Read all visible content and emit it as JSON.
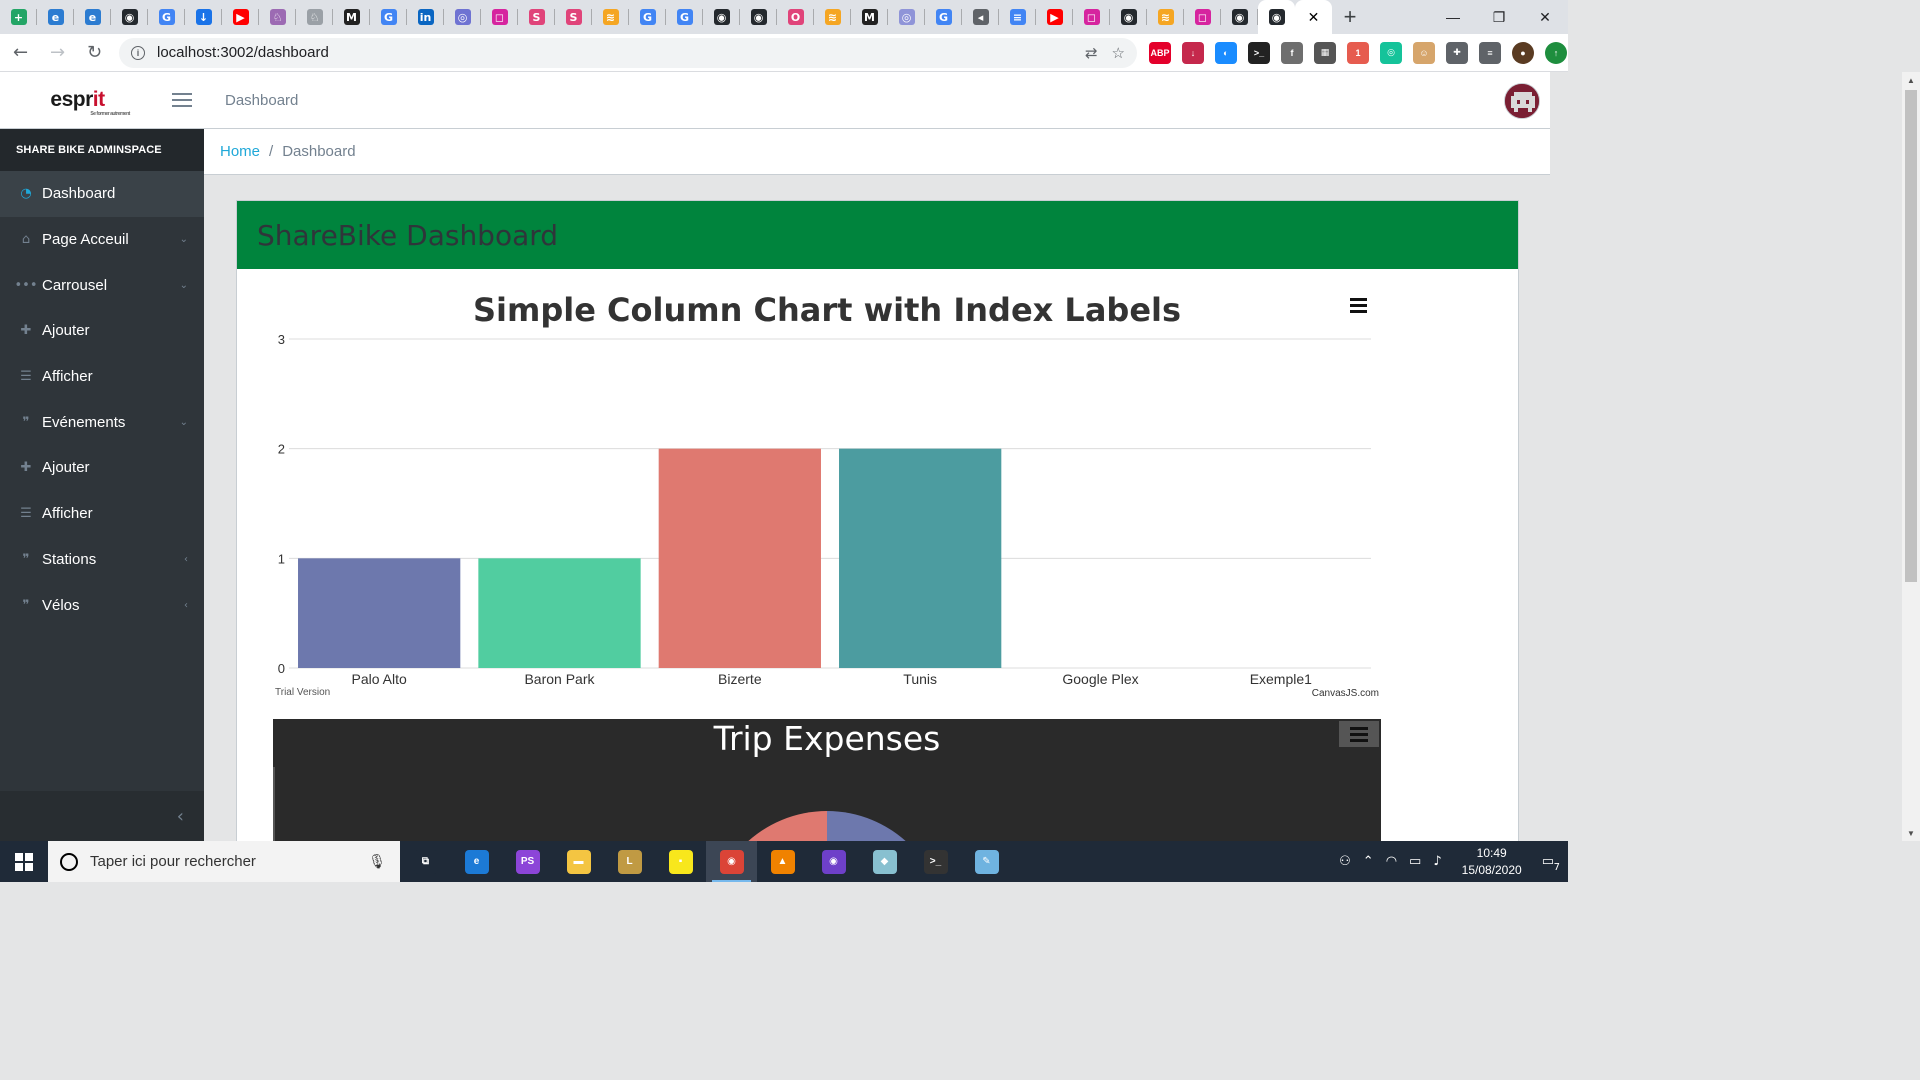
{
  "browser": {
    "tabs": [
      {
        "icon": "sheets-icon",
        "color": "#23a566",
        "glyph": "+"
      },
      {
        "icon": "edge-icon",
        "color": "#2c7cd1",
        "glyph": "e"
      },
      {
        "icon": "edge-icon",
        "color": "#2c7cd1",
        "glyph": "e"
      },
      {
        "icon": "github-icon",
        "color": "#24292e",
        "glyph": "◉"
      },
      {
        "icon": "google-icon",
        "color": "#4285f4",
        "glyph": "G"
      },
      {
        "icon": "download-icon",
        "color": "#1a73e8",
        "glyph": "↓"
      },
      {
        "icon": "youtube-icon",
        "color": "#ff0000",
        "glyph": "▶"
      },
      {
        "icon": "app-icon",
        "color": "#9c6ab3",
        "glyph": "♘"
      },
      {
        "icon": "app-icon",
        "color": "#9aa0a6",
        "glyph": "♘"
      },
      {
        "icon": "medium-icon",
        "color": "#222222",
        "glyph": "M"
      },
      {
        "icon": "google-icon",
        "color": "#4285f4",
        "glyph": "G"
      },
      {
        "icon": "linkedin-icon",
        "color": "#0a66c2",
        "glyph": "in"
      },
      {
        "icon": "app-icon",
        "color": "#6f73d2",
        "glyph": "◎"
      },
      {
        "icon": "instagram-icon",
        "color": "#d6249f",
        "glyph": "◻"
      },
      {
        "icon": "app-icon",
        "color": "#e0447a",
        "glyph": "S"
      },
      {
        "icon": "app-icon",
        "color": "#e0447a",
        "glyph": "S"
      },
      {
        "icon": "app-icon",
        "color": "#f5a623",
        "glyph": "≋"
      },
      {
        "icon": "google-icon",
        "color": "#4285f4",
        "glyph": "G"
      },
      {
        "icon": "google-icon",
        "color": "#4285f4",
        "glyph": "G"
      },
      {
        "icon": "github-icon",
        "color": "#24292e",
        "glyph": "◉"
      },
      {
        "icon": "github-icon",
        "color": "#24292e",
        "glyph": "◉"
      },
      {
        "icon": "opera-icon",
        "color": "#e0447a",
        "glyph": "O"
      },
      {
        "icon": "app-icon",
        "color": "#f5a623",
        "glyph": "≋"
      },
      {
        "icon": "medium-icon",
        "color": "#222222",
        "glyph": "M"
      },
      {
        "icon": "app-icon",
        "color": "#8f94d8",
        "glyph": "◎"
      },
      {
        "icon": "google-icon",
        "color": "#4285f4",
        "glyph": "G"
      },
      {
        "icon": "audio-icon",
        "color": "#5f6368",
        "glyph": "◂"
      },
      {
        "icon": "docs-icon",
        "color": "#4285f4",
        "glyph": "≡"
      },
      {
        "icon": "youtube-icon",
        "color": "#ff0000",
        "glyph": "▶"
      },
      {
        "icon": "instagram-icon",
        "color": "#d6249f",
        "glyph": "◻"
      },
      {
        "icon": "github-icon",
        "color": "#24292e",
        "glyph": "◉"
      },
      {
        "icon": "app-icon",
        "color": "#f5a623",
        "glyph": "≋"
      },
      {
        "icon": "instagram-icon",
        "color": "#d6249f",
        "glyph": "◻"
      },
      {
        "icon": "github-icon",
        "color": "#24292e",
        "glyph": "◉"
      },
      {
        "icon": "github-icon",
        "color": "#24292e",
        "glyph": "◉",
        "active": true
      }
    ],
    "active_tab_close": "✕",
    "new_tab": "+",
    "url": "localhost:3002/dashboard",
    "extensions": [
      {
        "icon": "adblock-icon",
        "color": "#e4002b",
        "glyph": "ABP"
      },
      {
        "icon": "download-manager-icon",
        "color": "#c5284c",
        "glyph": "↓"
      },
      {
        "icon": "messenger-icon",
        "color": "#1a8cff",
        "glyph": "◐"
      },
      {
        "icon": "terminal-icon",
        "color": "#222222",
        "glyph": ">_"
      },
      {
        "icon": "facebook-icon",
        "color": "#6e6e6e",
        "glyph": "f"
      },
      {
        "icon": "keyboard-icon",
        "color": "#555555",
        "glyph": "▦"
      },
      {
        "icon": "extension-badge-icon",
        "color": "#e65c4f",
        "glyph": "1"
      },
      {
        "icon": "grammarly-icon",
        "color": "#15c39a",
        "glyph": "◎"
      },
      {
        "icon": "avatar-ext-icon",
        "color": "#d6a56b",
        "glyph": "☺"
      },
      {
        "icon": "puzzle-icon",
        "color": "#5f6368",
        "glyph": "✚"
      },
      {
        "icon": "media-icon",
        "color": "#5f6368",
        "glyph": "≡"
      },
      {
        "icon": "profile-icon",
        "color": "#5a3b22",
        "glyph": "●"
      },
      {
        "icon": "update-icon",
        "color": "#1e8e3e",
        "glyph": "↑"
      }
    ]
  },
  "header": {
    "brand": "espr",
    "brand_accent": "it",
    "brand_sub": "Se former autrement",
    "link": "Dashboard"
  },
  "sidebar": {
    "title": "SHARE BIKE ADMINSPACE",
    "items": [
      {
        "label": "Dashboard",
        "icon": "speedometer-icon",
        "glyph": "◔",
        "arrow": "",
        "active": true
      },
      {
        "label": "Page Acceuil",
        "icon": "home-icon",
        "glyph": "⌂",
        "arrow": "⌄"
      },
      {
        "label": "Carrousel",
        "icon": "dots-icon",
        "glyph": "•••",
        "arrow": "⌄"
      },
      {
        "label": "Ajouter",
        "icon": "plus-icon",
        "glyph": "✚",
        "arrow": ""
      },
      {
        "label": "Afficher",
        "icon": "list-icon",
        "glyph": "☰",
        "arrow": ""
      },
      {
        "label": "Evénements",
        "icon": "quote-icon",
        "glyph": "❞",
        "arrow": "⌄"
      },
      {
        "label": "Ajouter",
        "icon": "plus-icon",
        "glyph": "✚",
        "arrow": ""
      },
      {
        "label": "Afficher",
        "icon": "list-icon",
        "glyph": "☰",
        "arrow": ""
      },
      {
        "label": "Stations",
        "icon": "quote-icon",
        "glyph": "❞",
        "arrow": "‹"
      },
      {
        "label": "Vélos",
        "icon": "quote-icon",
        "glyph": "❞",
        "arrow": "‹"
      }
    ],
    "collapse": "‹"
  },
  "breadcrumb": {
    "home": "Home",
    "sep": "/",
    "current": "Dashboard"
  },
  "card": {
    "title": "ShareBike Dashboard"
  },
  "chart_data": [
    {
      "type": "bar",
      "title": "Simple Column Chart with Index Labels",
      "categories": [
        "Palo Alto",
        "Baron Park",
        "Bizerte",
        "Tunis",
        "Google Plex",
        "Exemple1"
      ],
      "values": [
        1,
        1,
        2,
        2,
        0,
        0
      ],
      "colors": [
        "#6d78ad",
        "#51cda0",
        "#df7970",
        "#4c9ca0",
        "#ae7d99",
        "#c9d45c"
      ],
      "ylim": [
        0,
        3
      ],
      "yticks": [
        0,
        1,
        2,
        3
      ],
      "grid": true,
      "watermark_left": "Trial Version",
      "watermark_right": "CanvasJS.com",
      "menu_icon": "≡"
    },
    {
      "type": "pie",
      "title": "Trip Expenses",
      "menu_icon": "≡"
    }
  ],
  "taskbar": {
    "search_placeholder": "Taper ici pour rechercher",
    "apps": [
      {
        "icon": "task-view-icon",
        "color": "#1f2a38",
        "glyph": "⧉"
      },
      {
        "icon": "edge-icon",
        "color": "#1c7ad6",
        "glyph": "e"
      },
      {
        "icon": "phpstorm-icon",
        "color": "#8c45d8",
        "glyph": "PS"
      },
      {
        "icon": "file-explorer-icon",
        "color": "#f4c542",
        "glyph": "▬"
      },
      {
        "icon": "league-icon",
        "color": "#c09a43",
        "glyph": "L"
      },
      {
        "icon": "sticky-notes-icon",
        "color": "#f8e71c",
        "glyph": "▪"
      },
      {
        "icon": "chrome-icon",
        "color": "#db4437",
        "glyph": "◉",
        "active": true
      },
      {
        "icon": "vlc-icon",
        "color": "#f08200",
        "glyph": "▲"
      },
      {
        "icon": "github-desktop-icon",
        "color": "#6e40c9",
        "glyph": "◉"
      },
      {
        "icon": "app-icon",
        "color": "#88c0d0",
        "glyph": "◆"
      },
      {
        "icon": "terminal-icon",
        "color": "#333333",
        "glyph": ">_"
      },
      {
        "icon": "paint-icon",
        "color": "#6fb3e0",
        "glyph": "✎"
      }
    ],
    "time": "10:49",
    "date": "15/08/2020",
    "notifications": "7"
  }
}
